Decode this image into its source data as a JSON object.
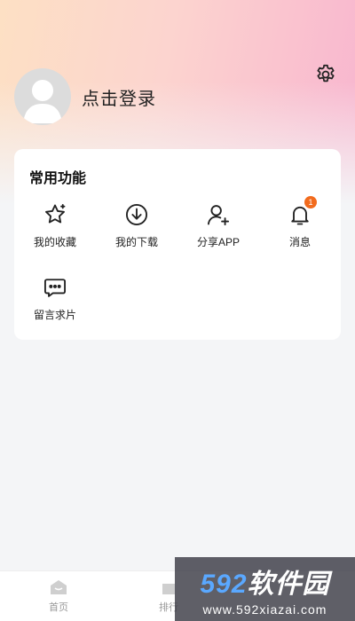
{
  "profile": {
    "login_label": "点击登录"
  },
  "common": {
    "title": "常用功能",
    "features": [
      {
        "label": "我的收藏",
        "icon": "star-icon"
      },
      {
        "label": "我的下载",
        "icon": "download-icon"
      },
      {
        "label": "分享APP",
        "icon": "add-user-icon"
      },
      {
        "label": "消息",
        "icon": "bell-icon",
        "badge": "1"
      },
      {
        "label": "留言求片",
        "icon": "message-icon"
      }
    ]
  },
  "tabbar": {
    "tabs": [
      {
        "label": "首页",
        "icon": "home-icon"
      },
      {
        "label": "排行",
        "icon": "rank-icon"
      }
    ]
  },
  "watermark": {
    "brand_num": "592",
    "brand_text": "软件园",
    "url": "www.592xiazai.com"
  },
  "colors": {
    "badge": "#f26b1d",
    "accent_gradient": [
      "#fde0c4",
      "#f8b5cf"
    ]
  }
}
